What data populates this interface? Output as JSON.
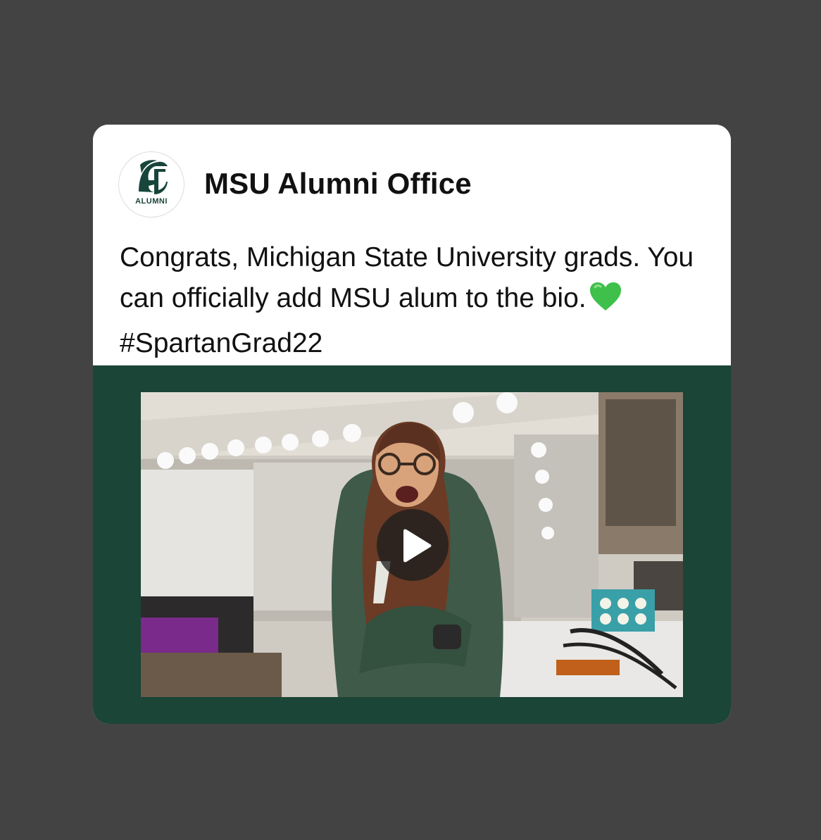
{
  "post": {
    "account_name": "MSU Alumni Office",
    "avatar_label": "ALUMNI",
    "text_before_emoji": "Congrats, Michigan State University grads. You can officially add MSU alum to the bio.",
    "emoji": "green-heart",
    "hashtag": "#SpartanGrad22"
  },
  "media": {
    "type": "video",
    "play_icon": "play-icon"
  },
  "colors": {
    "page_background": "#434343",
    "card_background": "#ffffff",
    "media_background": "#1b4536",
    "brand_green": "#18453b",
    "heart_green": "#3ec04b"
  }
}
